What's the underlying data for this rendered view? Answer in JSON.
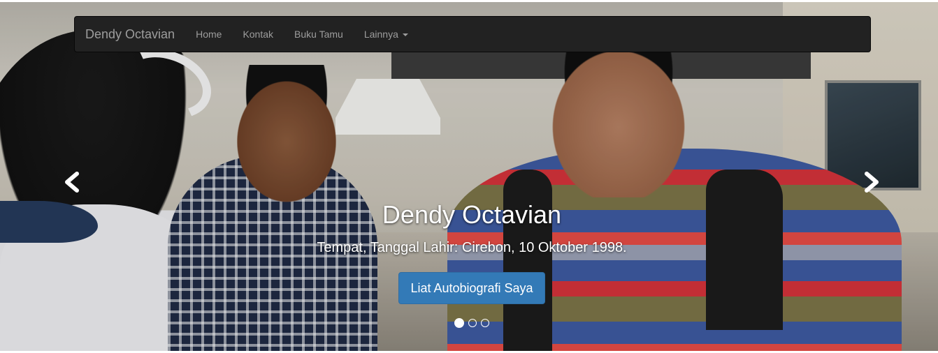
{
  "navbar": {
    "brand": "Dendy Octavian",
    "items": [
      {
        "label": "Home"
      },
      {
        "label": "Kontak"
      },
      {
        "label": "Buku Tamu"
      },
      {
        "label": "Lainnya"
      }
    ],
    "background": "#222222",
    "text_color": "#9d9d9d"
  },
  "carousel": {
    "caption": {
      "title": "Dendy Octavian",
      "subtitle": "Tempat, Tanggal Lahir: Cirebon, 10 Oktober 1998.",
      "button_label": "Liat Autobiografi Saya"
    },
    "controls": {
      "prev_icon": "chevron-left-icon",
      "next_icon": "chevron-right-icon"
    },
    "slide_count": 3,
    "active_slide": 1,
    "button_color": "#337ab7"
  }
}
